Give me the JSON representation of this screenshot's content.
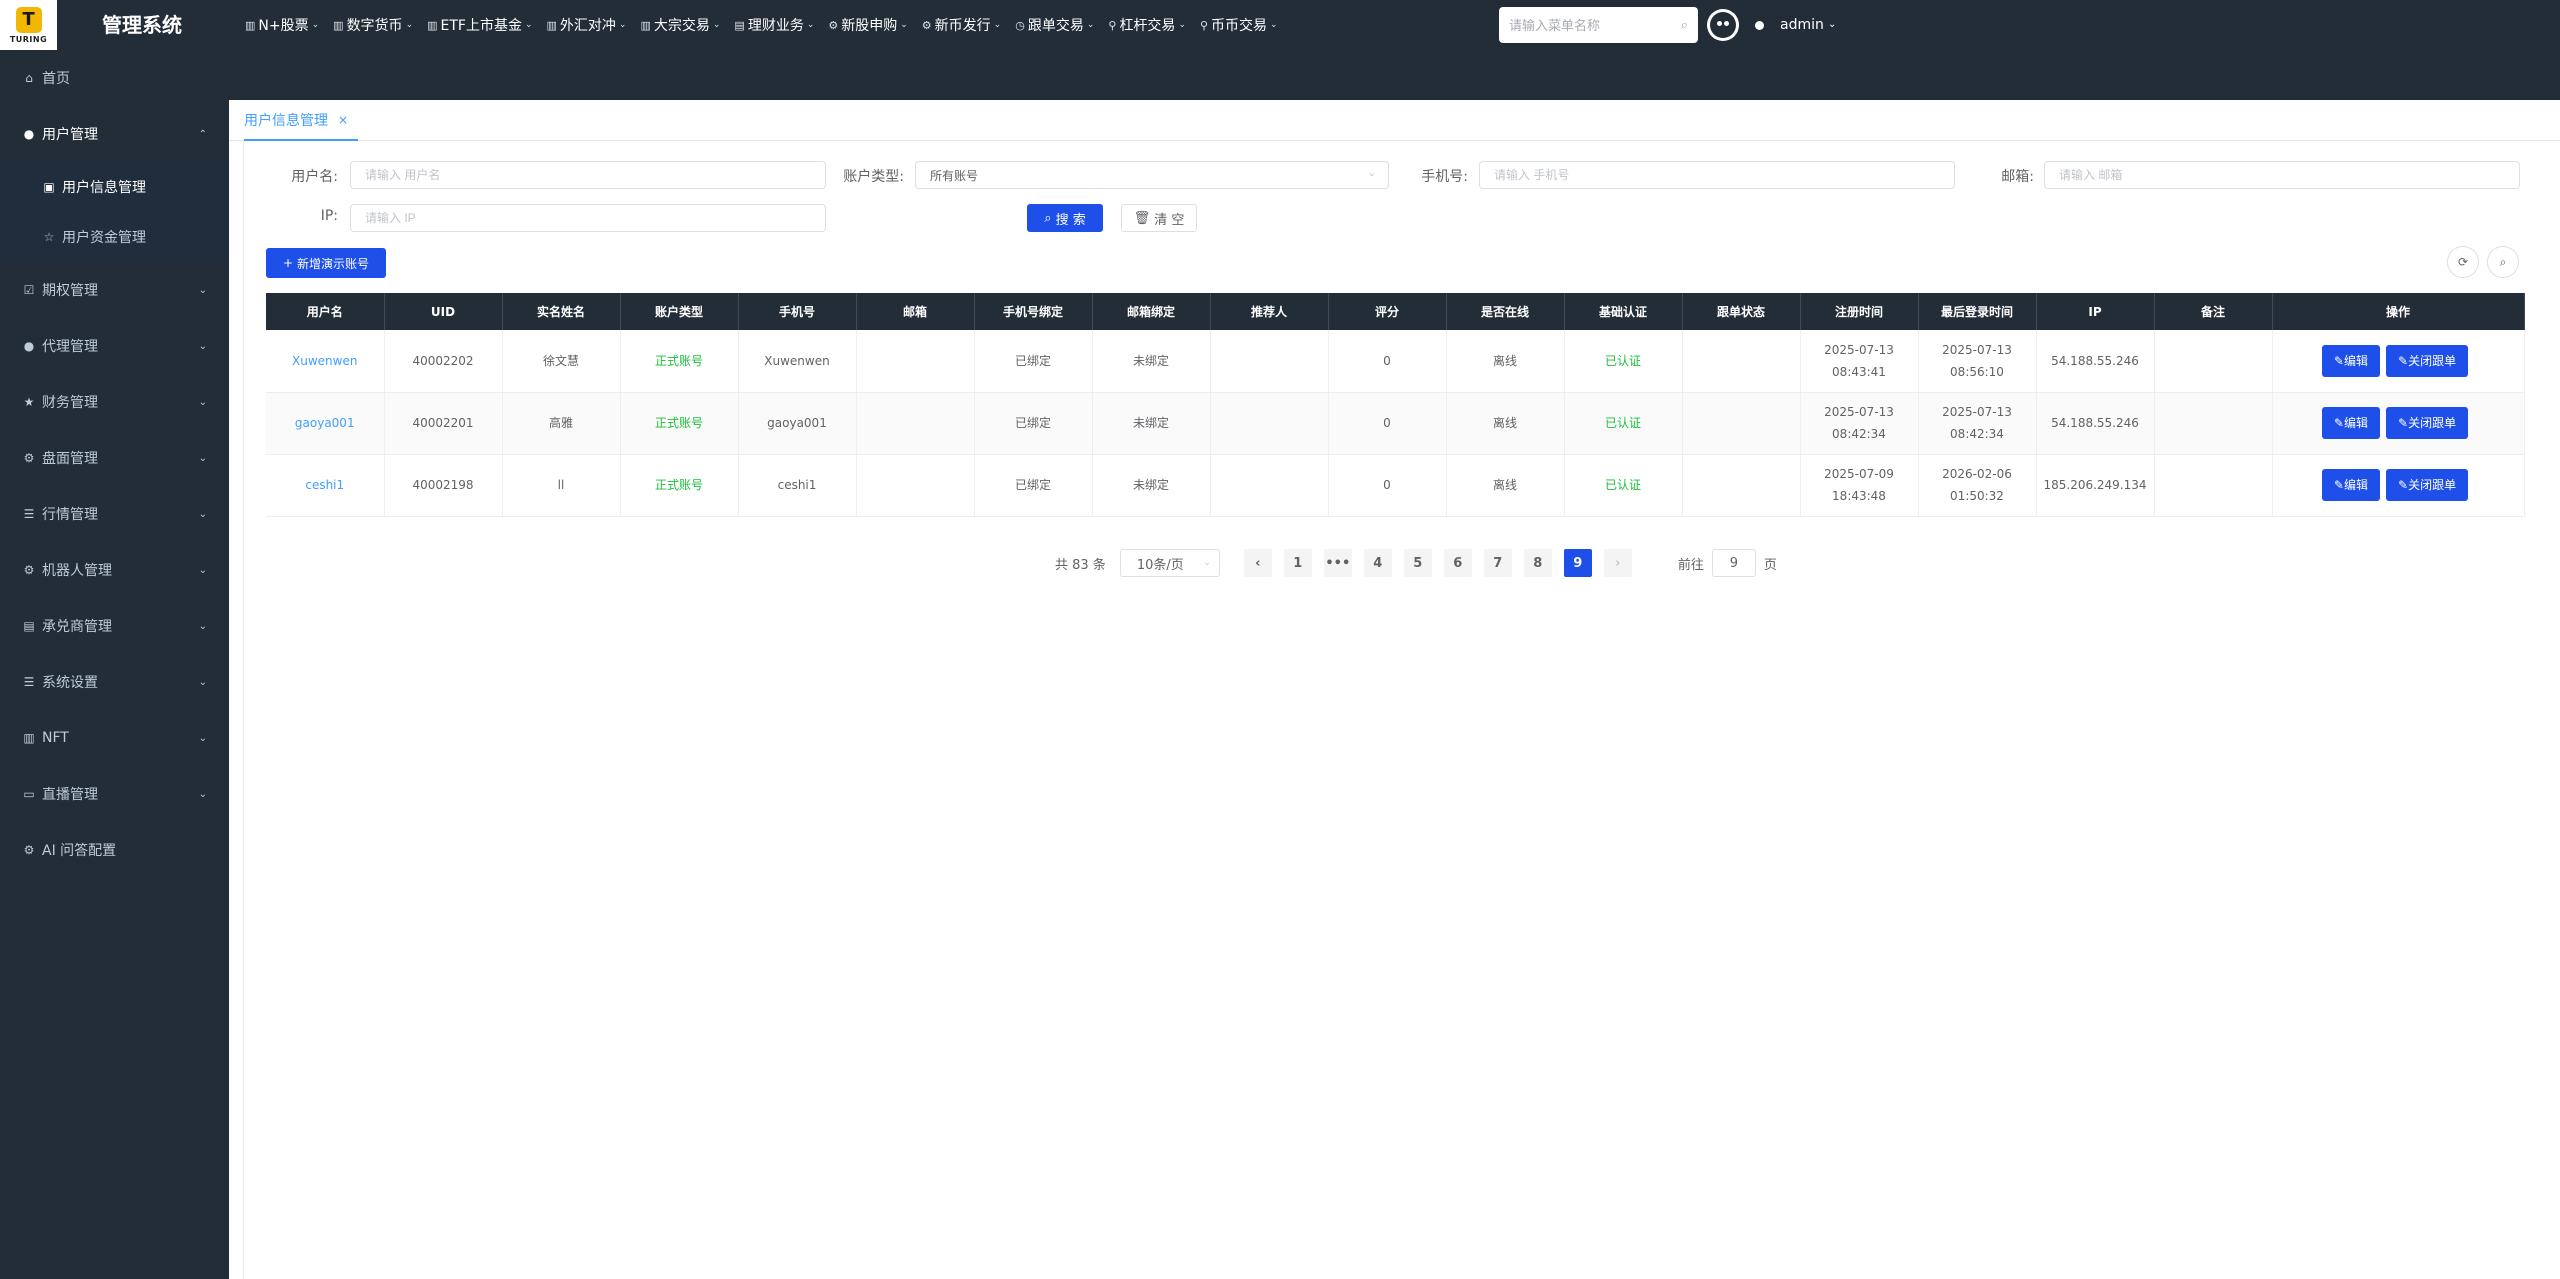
{
  "app": {
    "title": "管理系统",
    "logo_text": "TURING",
    "logo_letter": "T"
  },
  "topnav": [
    {
      "label": "N+股票",
      "icon": "bar-chart-icon",
      "glyph": "▥"
    },
    {
      "label": "数字货币",
      "icon": "bar-chart-icon",
      "glyph": "▥"
    },
    {
      "label": "ETF上市基金",
      "icon": "bar-chart-icon",
      "glyph": "▥"
    },
    {
      "label": "外汇对冲",
      "icon": "bar-chart-icon",
      "glyph": "▥"
    },
    {
      "label": "大宗交易",
      "icon": "bar-chart-icon",
      "glyph": "▥"
    },
    {
      "label": "理财业务",
      "icon": "list-icon",
      "glyph": "▤"
    },
    {
      "label": "新股申购",
      "icon": "gear-icon",
      "glyph": "⚙"
    },
    {
      "label": "新币发行",
      "icon": "gear-icon",
      "glyph": "⚙"
    },
    {
      "label": "跟单交易",
      "icon": "clock-icon",
      "glyph": "◷"
    },
    {
      "label": "杠杆交易",
      "icon": "lever-icon",
      "glyph": "⚲"
    },
    {
      "label": "币币交易",
      "icon": "pin-icon",
      "glyph": "⚲"
    }
  ],
  "header": {
    "search_placeholder": "请输入菜单名称",
    "user": "admin"
  },
  "sidebar": {
    "home": "首页",
    "items": [
      {
        "label": "用户管理",
        "icon": "user-icon",
        "glyph": "●",
        "open": true,
        "children": [
          {
            "label": "用户信息管理",
            "icon": "id-card-icon",
            "glyph": "▣",
            "active": true
          },
          {
            "label": "用户资金管理",
            "icon": "star-icon",
            "glyph": "☆",
            "active": false
          }
        ]
      },
      {
        "label": "期权管理",
        "icon": "check-square-icon",
        "glyph": "☑"
      },
      {
        "label": "代理管理",
        "icon": "user-icon",
        "glyph": "●"
      },
      {
        "label": "财务管理",
        "icon": "star-icon",
        "glyph": "★"
      },
      {
        "label": "盘面管理",
        "icon": "gear-icon",
        "glyph": "⚙"
      },
      {
        "label": "行情管理",
        "icon": "list-icon",
        "glyph": "☰"
      },
      {
        "label": "机器人管理",
        "icon": "gear-icon",
        "glyph": "⚙"
      },
      {
        "label": "承兑商管理",
        "icon": "list-icon",
        "glyph": "▤"
      },
      {
        "label": "系统设置",
        "icon": "list-icon",
        "glyph": "☰"
      },
      {
        "label": "NFT",
        "icon": "bar-chart-icon",
        "glyph": "▥"
      },
      {
        "label": "直播管理",
        "icon": "video-icon",
        "glyph": "▭"
      },
      {
        "label": "AI 问答配置",
        "icon": "gear-icon",
        "glyph": "⚙"
      }
    ]
  },
  "tabs": [
    {
      "label": "用户信息管理",
      "close": "×"
    }
  ],
  "filters": {
    "username_label": "用户名:",
    "username_placeholder": "请输入 用户名",
    "account_type_label": "账户类型:",
    "account_type_value": "所有账号",
    "phone_label": "手机号:",
    "phone_placeholder": "请输入 手机号",
    "email_label": "邮箱:",
    "email_placeholder": "请输入 邮箱",
    "ip_label": "IP:",
    "ip_placeholder": "请输入 IP",
    "search_btn": "搜 索",
    "clear_btn": "清 空"
  },
  "toolbar": {
    "add_demo": "新增演示账号"
  },
  "table": {
    "headers": [
      "用户名",
      "UID",
      "实名姓名",
      "账户类型",
      "手机号",
      "邮箱",
      "手机号绑定",
      "邮箱绑定",
      "推荐人",
      "评分",
      "是否在线",
      "基础认证",
      "跟单状态",
      "注册时间",
      "最后登录时间",
      "IP",
      "备注",
      "操作"
    ],
    "rows": [
      [
        "Xuwenwen",
        "40002202",
        "徐文慧",
        "正式账号",
        "Xuwenwen",
        "",
        "已绑定",
        "未绑定",
        "",
        "0",
        "离线",
        "已认证",
        "",
        "2025-07-13 08:43:41",
        "2025-07-13 08:56:10",
        "54.188.55.246",
        ""
      ],
      [
        "gaoya001",
        "40002201",
        "高雅",
        "正式账号",
        "gaoya001",
        "",
        "已绑定",
        "未绑定",
        "",
        "0",
        "离线",
        "已认证",
        "",
        "2025-07-13 08:42:34",
        "2025-07-13 08:42:34",
        "54.188.55.246",
        ""
      ],
      [
        "ceshi1",
        "40002198",
        "ll",
        "正式账号",
        "ceshi1",
        "",
        "已绑定",
        "未绑定",
        "",
        "0",
        "离线",
        "已认证",
        "",
        "2025-07-09 18:43:48",
        "2026-02-06 01:50:32",
        "185.206.249.134",
        ""
      ]
    ],
    "edit_btn": "编辑",
    "close_copy_btn": "关闭跟单"
  },
  "pagination": {
    "total": "共 83 条",
    "page_size": "10条/页",
    "pages": [
      "1",
      "•••",
      "4",
      "5",
      "6",
      "7",
      "8",
      "9"
    ],
    "current": "9",
    "goto_label": "前往",
    "goto_value": "9",
    "page_unit": "页"
  }
}
